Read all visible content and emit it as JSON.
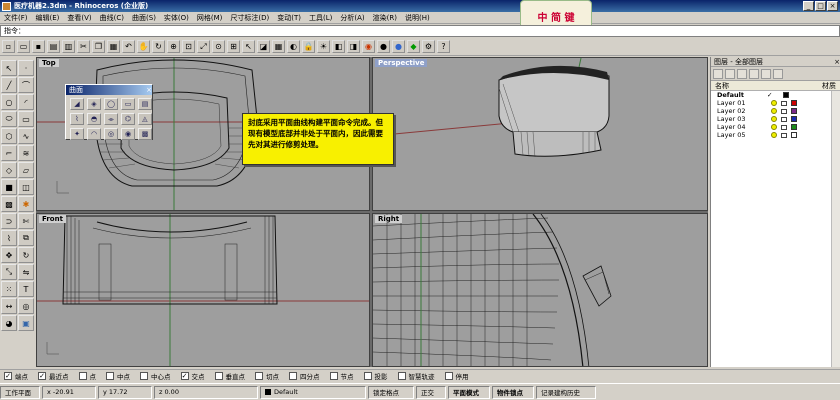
{
  "window": {
    "title": "医疗机器2.3dm - Rhinoceros (企业版)",
    "buttons": [
      "_",
      "□",
      "×"
    ]
  },
  "badge": {
    "text": "中 简 键"
  },
  "menu": [
    "文件(F)",
    "编辑(E)",
    "查看(V)",
    "曲线(C)",
    "曲面(S)",
    "实体(O)",
    "网格(M)",
    "尺寸标注(D)",
    "变动(T)",
    "工具(L)",
    "分析(A)",
    "渲染(R)",
    "说明(H)"
  ],
  "command": {
    "prompt": "指令：",
    "value": ""
  },
  "viewports": {
    "top": "Top",
    "perspective": "Perspective",
    "front": "Front",
    "right": "Right"
  },
  "curve_panel": {
    "title": "曲面",
    "close": "×"
  },
  "note": {
    "text": "封底采用平面曲线构建平面命令完成。但现有模型底部并非处于平面内，因此需要先对其进行修剪处理。"
  },
  "layers": {
    "header": "图层 - 全部图层",
    "col_name": "名称",
    "col_material": "材质",
    "rows": [
      {
        "name": "Default",
        "check": "✓",
        "color": "#000000"
      },
      {
        "name": "Layer 01",
        "check": "",
        "color": "#cc0000"
      },
      {
        "name": "Layer 02",
        "check": "",
        "color": "#7a2a8a"
      },
      {
        "name": "Layer 03",
        "check": "",
        "color": "#1a2ab0"
      },
      {
        "name": "Layer 04",
        "check": "",
        "color": "#1a8a1a"
      },
      {
        "name": "Layer 05",
        "check": "",
        "color": "#ffffff"
      }
    ]
  },
  "osnaps": [
    {
      "label": "端点",
      "checked": "✓"
    },
    {
      "label": "最近点",
      "checked": "✓"
    },
    {
      "label": "点",
      "checked": ""
    },
    {
      "label": "中点",
      "checked": ""
    },
    {
      "label": "中心点",
      "checked": ""
    },
    {
      "label": "交点",
      "checked": "✓"
    },
    {
      "label": "垂直点",
      "checked": ""
    },
    {
      "label": "切点",
      "checked": ""
    },
    {
      "label": "四分点",
      "checked": ""
    },
    {
      "label": "节点",
      "checked": ""
    },
    {
      "label": "投影",
      "checked": ""
    },
    {
      "label": "智慧轨迹",
      "checked": ""
    },
    {
      "label": "停用",
      "checked": ""
    }
  ],
  "status": {
    "cplane": "工作平面",
    "x": "x -20.91",
    "y": "y 17.72",
    "z": "z 0.00",
    "layer": "Default",
    "grid_snap": "锁定格点",
    "ortho": "正交",
    "planar": "平面模式",
    "osnap": "物件锁点",
    "history": "记录建构历史"
  }
}
